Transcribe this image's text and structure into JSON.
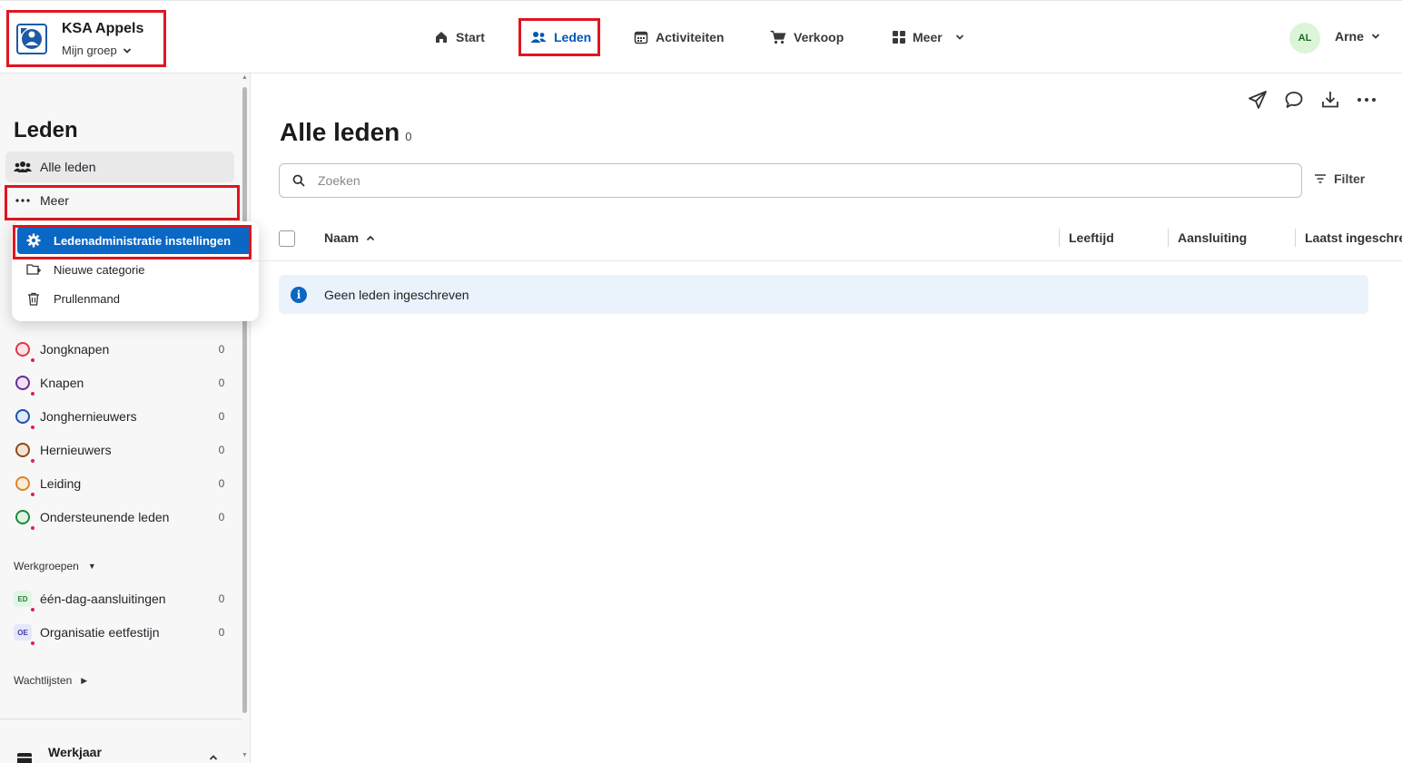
{
  "org": {
    "name": "KSA Appels",
    "group_label": "Mijn groep"
  },
  "nav": [
    {
      "label": "Start",
      "icon": "home-icon"
    },
    {
      "label": "Leden",
      "icon": "users-icon",
      "active": true
    },
    {
      "label": "Activiteiten",
      "icon": "calendar-icon"
    },
    {
      "label": "Verkoop",
      "icon": "cart-icon"
    },
    {
      "label": "Meer",
      "icon": "grid-icon"
    }
  ],
  "user": {
    "initials": "AL",
    "name": "Arne"
  },
  "sidebar": {
    "title": "Leden",
    "all_members": "Alle leden",
    "more": "Meer",
    "categories": [
      {
        "label": "Jongknapen",
        "count": "0",
        "color": "#e3344b"
      },
      {
        "label": "Knapen",
        "count": "0",
        "color": "#6a2d91"
      },
      {
        "label": "Jonghernieuwers",
        "count": "0",
        "color": "#1f4fa8"
      },
      {
        "label": "Hernieuwers",
        "count": "0",
        "color": "#8a4b1c"
      },
      {
        "label": "Leiding",
        "count": "0",
        "color": "#d9862a"
      },
      {
        "label": "Ondersteunende leden",
        "count": "0",
        "color": "#1a8a3c"
      }
    ],
    "workgroups_title": "Werkgroepen",
    "workgroups": [
      {
        "badge": "ED",
        "label": "één-dag-aansluitingen",
        "count": "0",
        "bg": "#e1f5e4",
        "fg": "#2c7a35"
      },
      {
        "badge": "OE",
        "label": "Organisatie eetfestijn",
        "count": "0",
        "bg": "#e6e6fa",
        "fg": "#3e3e9a"
      }
    ],
    "waitlists_title": "Wachtlijsten",
    "werkjaar": "Werkjaar"
  },
  "menu": {
    "items": [
      {
        "label": "Ledenadministratie instellingen",
        "icon": "gear-icon"
      },
      {
        "label": "Nieuwe categorie",
        "icon": "folder-add-icon"
      },
      {
        "label": "Prullenmand",
        "icon": "trash-icon"
      }
    ]
  },
  "main": {
    "title": "Alle leden",
    "count": "0",
    "search_placeholder": "Zoeken",
    "filter_label": "Filter",
    "columns": [
      "Naam",
      "Leeftijd",
      "Aansluiting",
      "Laatst ingeschreven"
    ],
    "empty_message": "Geen leden ingeschreven"
  },
  "colors": {
    "accent": "#0057b8",
    "highlight": "#0a67c4",
    "annotation": "#e0151f"
  }
}
